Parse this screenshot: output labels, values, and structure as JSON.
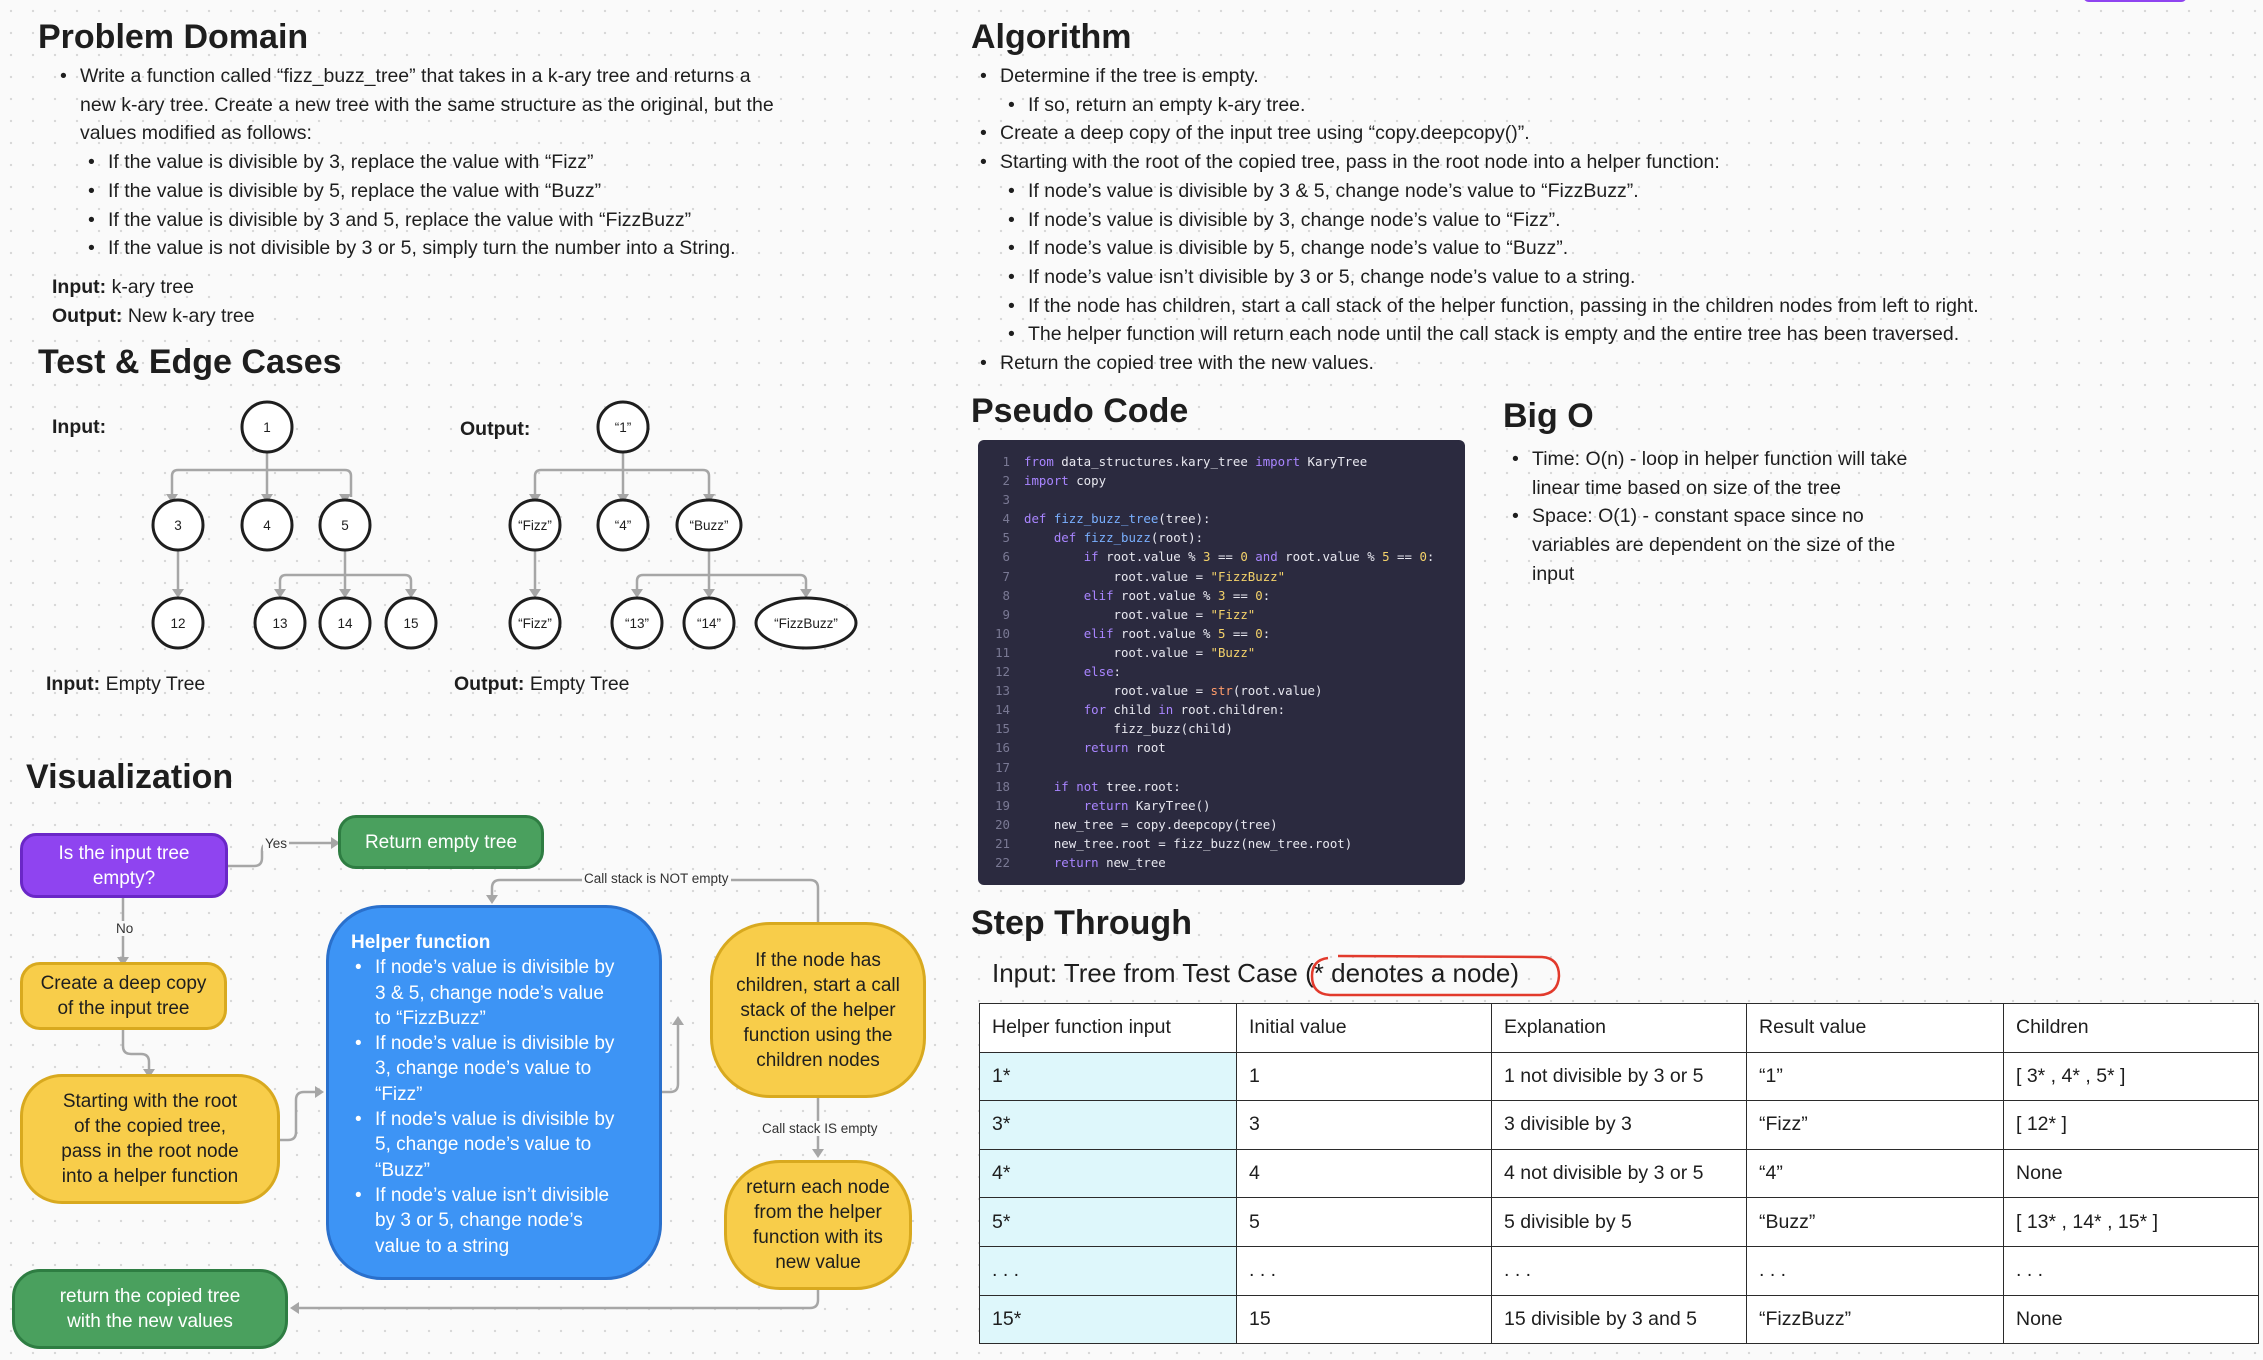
{
  "problem": {
    "title": "Problem Domain",
    "intro_lines": [
      "Write a function called “fizz_buzz_tree” that takes in a k-ary tree and returns a",
      "new k-ary tree. Create a new tree with the same structure as the original, but the",
      "values modified as follows:"
    ],
    "rules": [
      "If the value is divisible by 3, replace the value with “Fizz”",
      "If the value is divisible by 5, replace the value with “Buzz”",
      "If the value is divisible by 3 and 5, replace the value with “FizzBuzz”",
      "If the value is not divisible by 3 or 5, simply turn the number into a String."
    ],
    "input_label": "Input:",
    "input_value": "k-ary tree",
    "output_label": "Output:",
    "output_value": "New k-ary tree"
  },
  "tests": {
    "title": "Test & Edge Cases",
    "input_label": "Input:",
    "output_label": "Output:",
    "input_nodes": [
      "1",
      "3",
      "4",
      "5",
      "12",
      "13",
      "14",
      "15"
    ],
    "output_nodes": [
      "“1”",
      "“Fizz”",
      "“4”",
      "“Buzz”",
      "“Fizz”",
      "“13”",
      "“14”",
      "“FizzBuzz”"
    ],
    "empty_input_label": "Input:",
    "empty_input_value": "Empty Tree",
    "empty_output_label": "Output:",
    "empty_output_value": "Empty Tree"
  },
  "algorithm": {
    "title": "Algorithm",
    "steps": [
      "Determine if the tree is empty.",
      "If so, return an empty k-ary tree.",
      "Create a deep copy of the input tree using “copy.deepcopy()”.",
      "Starting with the root of the copied tree, pass in the root node into a helper function:",
      "If node’s value is divisible by 3 & 5, change node’s value to “FizzBuzz”.",
      "If node’s value is divisible by 3, change node’s value to “Fizz”.",
      "If node’s value is divisible by 5, change node’s value to “Buzz”.",
      "If node’s value isn’t divisible by 3 or 5, change node’s value to a string.",
      "If the node has children, start a call stack of the helper function, passing in the children nodes from left to right.",
      "The helper function will return each node until the call stack is empty and the entire tree has been traversed.",
      "Return the copied tree with the new values."
    ]
  },
  "pseudo": {
    "title": "Pseudo Code",
    "line_numbers": [
      "1",
      "2",
      "3",
      "4",
      "5",
      "6",
      "7",
      "8",
      "9",
      "10",
      "11",
      "12",
      "13",
      "14",
      "15",
      "16",
      "17",
      "18",
      "19",
      "20",
      "21",
      "22"
    ]
  },
  "bigo": {
    "title": "Big O",
    "time_lines": [
      "Time: O(n) - loop in helper function will take",
      "linear time based on size of the tree"
    ],
    "space_lines": [
      "Space: O(1) - constant space since no",
      "variables are dependent on the size of the",
      "input"
    ]
  },
  "step_through": {
    "title": "Step Through",
    "caption_prefix": "Input: Tree from Test Case",
    "caption_note": "(* denotes a node)",
    "headers": [
      "Helper function input",
      "Initial value",
      "Explanation",
      "Result value",
      "Children"
    ],
    "rows": [
      [
        "1*",
        "1",
        "1 not divisible by 3 or 5",
        "“1”",
        "[ 3* , 4* , 5* ]"
      ],
      [
        "3*",
        "3",
        "3 divisible by 3",
        "“Fizz”",
        "[ 12* ]"
      ],
      [
        "4*",
        "4",
        "4 not divisible by 3 or 5",
        "“4”",
        "None"
      ],
      [
        "5*",
        "5",
        "5 divisible by 5",
        "“Buzz”",
        "[ 13* , 14* , 15* ]"
      ],
      [
        ". . .",
        ". . .",
        ". . .",
        ". . .",
        ". . ."
      ],
      [
        "15*",
        "15",
        "15 divisible by 3 and 5",
        "“FizzBuzz”",
        "None"
      ]
    ]
  },
  "visual": {
    "title": "Visualization",
    "is_empty_lines": [
      "Is the input tree",
      "empty?"
    ],
    "return_empty": "Return empty tree",
    "deep_copy_lines": [
      "Create a deep copy",
      "of the input tree"
    ],
    "start_root_lines": [
      "Starting with the root",
      "of the copied tree,",
      "pass in the root node",
      "into a helper function"
    ],
    "helper_title": "Helper function",
    "helper_items": [
      [
        "If node’s value is divisible by",
        "3 & 5, change node’s value",
        "to “FizzBuzz”"
      ],
      [
        "If node’s value is divisible by",
        "3, change node’s value to",
        "“Fizz”"
      ],
      [
        "If node’s value is divisible by",
        "5, change node’s value to",
        "“Buzz”"
      ],
      [
        "If node’s value isn’t divisible",
        "by 3 or 5, change node’s",
        "value to a string"
      ]
    ],
    "children_lines": [
      "If the node has",
      "children, start a call",
      "stack of the helper",
      "function using the",
      "children nodes"
    ],
    "return_each_lines": [
      "return each node",
      "from the helper",
      "function with its",
      "new value"
    ],
    "return_copied_lines": [
      "return the copied tree",
      "with the new values"
    ],
    "label_yes": "Yes",
    "label_no": "No",
    "label_not_empty": "Call stack is NOT empty",
    "label_is_empty": "Call stack IS empty"
  },
  "colors": {
    "yellow": "#f8cd4a",
    "green": "#4aa05e",
    "purple": "#8f44f0",
    "blue": "#3d94f5",
    "table_highlight": "#def7fb",
    "code_bg": "#2b2a3f",
    "annotation_red": "#e23a2c"
  }
}
